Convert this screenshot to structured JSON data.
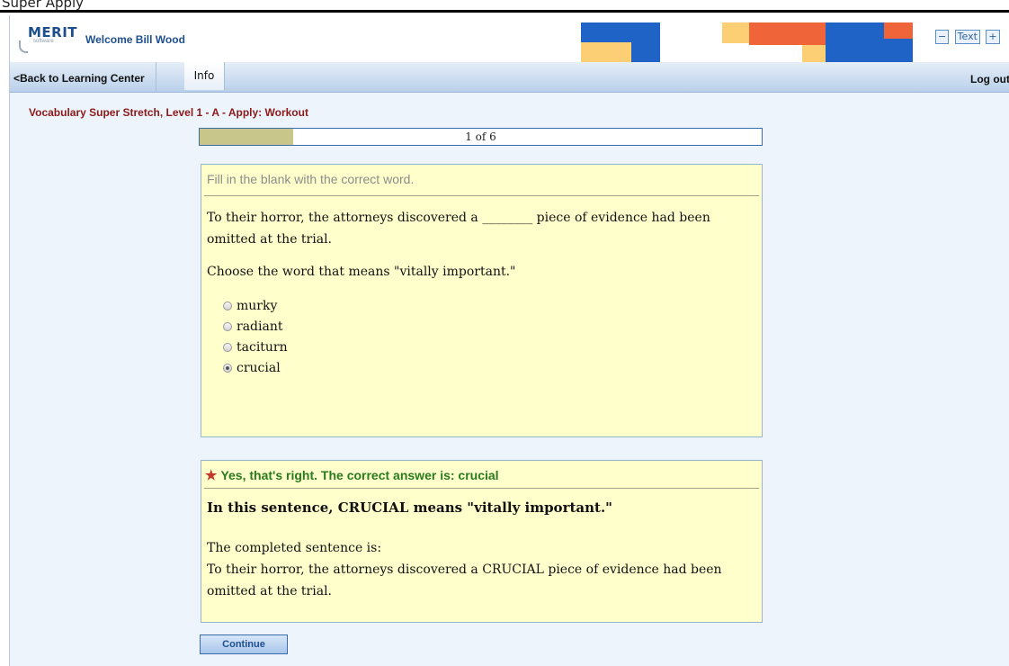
{
  "browser_strip": {
    "text": "Super Apply"
  },
  "header": {
    "logo_text": "MERIT",
    "logo_sub": "software",
    "welcome": "Welcome Bill Wood",
    "text_size": {
      "minus": "−",
      "label": "Text",
      "plus": "+"
    },
    "logout": "Log out"
  },
  "nav": {
    "back": "<Back to Learning Center",
    "info": "Info"
  },
  "lesson": {
    "title": "Vocabulary Super Stretch, Level 1 - A - Apply: Workout"
  },
  "progress": {
    "text": "1 of 6",
    "fraction": 0.167
  },
  "question": {
    "instruction": "Fill in the blank with the correct word.",
    "sentence": "To their horror, the attorneys discovered a ________ piece of evidence had been omitted at the trial.",
    "prompt": "Choose the word that means \"vitally important.\"",
    "options": [
      {
        "label": "murky",
        "selected": false
      },
      {
        "label": "radiant",
        "selected": false
      },
      {
        "label": "taciturn",
        "selected": false
      },
      {
        "label": "crucial",
        "selected": true
      }
    ]
  },
  "feedback": {
    "result": "Yes, that's right. The correct answer is: crucial",
    "meaning": "In this sentence, CRUCIAL means \"vitally important.\"",
    "completed_label": "The completed sentence is:",
    "completed_sentence": "To their horror, the attorneys discovered a CRUCIAL piece of evidence had been omitted at the trial."
  },
  "buttons": {
    "continue": "Continue"
  },
  "colors": {
    "accent_blue": "#1d4f8f",
    "lesson_title": "#8b1a1a",
    "correct_green": "#2a7a1e",
    "panel_bg": "#ffffcc",
    "mosaic_blue": "#1f63c6",
    "mosaic_orange": "#f0643a",
    "mosaic_yellow": "#fccf74"
  }
}
